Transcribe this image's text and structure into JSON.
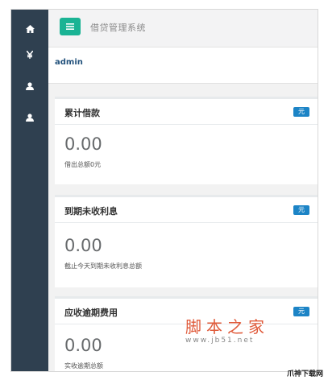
{
  "sidebar": {
    "items": [
      {
        "icon": "home-icon"
      },
      {
        "icon": "yen-icon"
      },
      {
        "icon": "user-icon"
      },
      {
        "icon": "user-icon"
      }
    ]
  },
  "topbar": {
    "menu_icon": "menu-icon",
    "title": "借贷管理系统"
  },
  "user": {
    "name": "admin"
  },
  "cards": [
    {
      "title": "累计借款",
      "badge": "元",
      "value": "0.00",
      "desc": "借出总额0元"
    },
    {
      "title": "到期未收利息",
      "badge": "元",
      "value": "0.00",
      "desc": "截止今天到期未收利息总额"
    },
    {
      "title": "应收逾期费用",
      "badge": "元",
      "value": "0.00",
      "desc": "实收逾期总额"
    }
  ],
  "watermark": {
    "text": "脚本之家",
    "url": "www.jb51.net"
  },
  "corner_logo": "爪神下载网",
  "colors": {
    "sidebar": "#2f4050",
    "accent": "#1ab394",
    "badge": "#1c84c6"
  }
}
